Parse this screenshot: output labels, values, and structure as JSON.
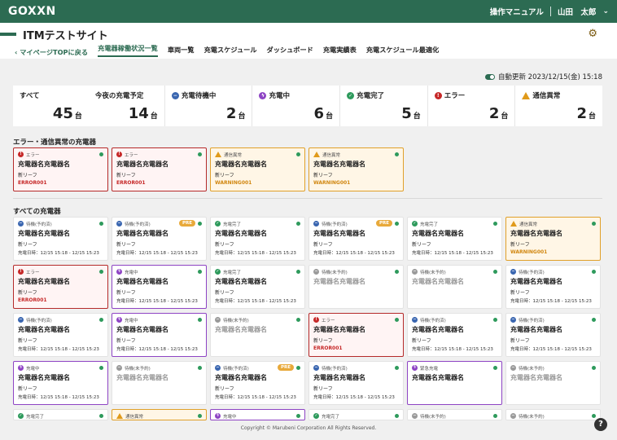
{
  "header": {
    "logo": "GOXXN",
    "manual": "操作マニュアル",
    "user": "山田　太郎"
  },
  "page": {
    "title": "ITMテストサイト",
    "back": "マイページTOPに戻る",
    "tabs": [
      "充電器稼働状況一覧",
      "車両一覧",
      "充電スケジュール",
      "ダッシュボード",
      "充電実績表",
      "充電スケジュール最適化"
    ],
    "auto_update": "自動更新 2023/12/15(金) 15:18"
  },
  "summary": {
    "all_label": "すべて",
    "all_value": "45",
    "tonight_label": "今夜の充電予定",
    "tonight_value": "14",
    "wait_label": "充電待機中",
    "wait_value": "2",
    "charging_label": "充電中",
    "charging_value": "6",
    "done_label": "充電完了",
    "done_value": "5",
    "error_label": "エラー",
    "error_value": "2",
    "warn_label": "通信異常",
    "warn_value": "2",
    "unit": "台"
  },
  "sections": {
    "errors_title": "エラー・通信異常の充電器",
    "all_title": "すべての充電器"
  },
  "alert_cards": [
    {
      "type": "error",
      "status": "エラー",
      "name": "充電器名充電器名",
      "sub": "新リーフ",
      "code": "ERROR001"
    },
    {
      "type": "error",
      "status": "エラー",
      "name": "充電器名充電器名",
      "sub": "新リーフ",
      "code": "ERROR001"
    },
    {
      "type": "warn",
      "status": "通信異常",
      "name": "充電器名充電器名",
      "sub": "新リーフ",
      "code": "WARNING001"
    },
    {
      "type": "warn",
      "status": "通信異常",
      "name": "充電器名充電器名",
      "sub": "新リーフ",
      "code": "WARNING001"
    }
  ],
  "cards": [
    {
      "type": "wait",
      "status": "待機(予約済)",
      "name": "充電器名充電器名",
      "sub": "新リーフ",
      "time": "充電日時：12/15 15:18 - 12/15 15:23"
    },
    {
      "type": "wait",
      "status": "待機(予約済)",
      "pre": "PRE",
      "name": "充電器名充電器名",
      "sub": "新リーフ",
      "time": "充電日時：12/15 15:18 - 12/15 15:23"
    },
    {
      "type": "done",
      "status": "充電完了",
      "name": "充電器名充電器名",
      "sub": "新リーフ",
      "time": "充電日時：12/15 15:18 - 12/15 15:23"
    },
    {
      "type": "wait",
      "status": "待機(予約済)",
      "pre": "PRE",
      "name": "充電器名充電器名",
      "sub": "新リーフ",
      "time": "充電日時：12/15 15:18 - 12/15 15:23"
    },
    {
      "type": "done",
      "status": "充電完了",
      "name": "充電器名充電器名",
      "sub": "新リーフ",
      "time": "充電日時：12/15 15:18 - 12/15 15:23"
    },
    {
      "type": "warn",
      "status": "通信異常",
      "name": "充電器名充電器名",
      "sub": "新リーフ",
      "code": "WARNING001"
    },
    {
      "type": "error",
      "status": "エラー",
      "name": "充電器名充電器名",
      "sub": "新リーフ",
      "code": "ERROR001"
    },
    {
      "type": "charging",
      "status": "充電中",
      "name": "充電器名充電器名",
      "sub": "新リーフ",
      "time": "充電日時：12/15 15:18 - 12/15 15:23"
    },
    {
      "type": "done",
      "status": "充電完了",
      "name": "充電器名充電器名",
      "sub": "新リーフ",
      "time": "充電日時：12/15 15:18 - 12/15 15:23"
    },
    {
      "type": "idle",
      "status": "待機(未予約)",
      "name": "充電器名充電器名"
    },
    {
      "type": "idle",
      "status": "待機(未予約)",
      "name": "充電器名充電器名"
    },
    {
      "type": "wait",
      "status": "待機(予約済)",
      "name": "充電器名充電器名",
      "sub": "新リーフ",
      "time": "充電日時：12/15 15:18 - 12/15 15:23"
    },
    {
      "type": "wait",
      "status": "待機(予約済)",
      "name": "充電器名充電器名",
      "sub": "新リーフ",
      "time": "充電日時：12/15 15:18 - 12/15 15:23"
    },
    {
      "type": "charging",
      "status": "充電中",
      "name": "充電器名充電器名",
      "sub": "新リーフ",
      "time": "充電日時：12/15 15:18 - 12/15 15:23"
    },
    {
      "type": "idle",
      "status": "待機(未予約)",
      "name": "充電器名充電器名"
    },
    {
      "type": "error",
      "status": "エラー",
      "name": "充電器名充電器名",
      "sub": "新リーフ",
      "code": "ERROR001"
    },
    {
      "type": "wait",
      "status": "待機(予約済)",
      "name": "充電器名充電器名",
      "sub": "新リーフ",
      "time": "充電日時：12/15 15:18 - 12/15 15:23"
    },
    {
      "type": "wait",
      "status": "待機(予約済)",
      "name": "充電器名充電器名",
      "sub": "新リーフ",
      "time": "充電日時：12/15 15:18 - 12/15 15:23"
    },
    {
      "type": "charging",
      "status": "充電中",
      "name": "充電器名充電器名",
      "sub": "新リーフ",
      "time": "充電日時：12/15 15:18 - 12/15 15:23"
    },
    {
      "type": "idle",
      "status": "待機(未予約)",
      "name": "充電器名充電器名"
    },
    {
      "type": "wait",
      "status": "待機(予約済)",
      "pre": "PRE",
      "name": "充電器名充電器名",
      "sub": "新リーフ",
      "time": "充電日時：12/15 15:18 - 12/15 15:23"
    },
    {
      "type": "wait",
      "status": "待機(予約済)",
      "name": "充電器名充電器名",
      "sub": "新リーフ",
      "time": "充電日時：12/15 15:18 - 12/15 15:23"
    },
    {
      "type": "charging",
      "status": "緊急充電",
      "name": "充電器名充電器名"
    },
    {
      "type": "idle",
      "status": "待機(未予約)",
      "name": "充電器名充電器名"
    },
    {
      "type": "done",
      "status": "充電完了"
    },
    {
      "type": "warn",
      "status": "通信異常"
    },
    {
      "type": "charging",
      "status": "充電中"
    },
    {
      "type": "done",
      "status": "充電完了"
    },
    {
      "type": "idle",
      "status": "待機(未予約)"
    },
    {
      "type": "idle",
      "status": "待機(未予約)"
    }
  ],
  "footer": {
    "copyright": "Copyright © Marubeni Corporation All Rights Reserved.",
    "help": "?"
  },
  "colors": {
    "brand": "#2c6b52",
    "error": "#c62828",
    "warn": "#e09a1a",
    "charging": "#8e44c4",
    "wait": "#3a66b0",
    "done": "#2e9a5c"
  }
}
